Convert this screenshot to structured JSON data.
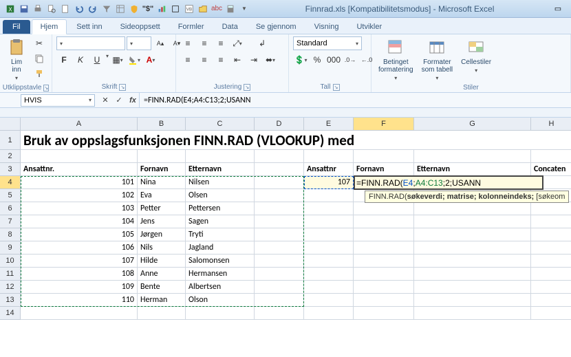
{
  "title": "Finnrad.xls  [Kompatibilitetsmodus] - Microsoft Excel",
  "tabs": {
    "fil": "Fil",
    "hjem": "Hjem",
    "settinn": "Sett inn",
    "sideoppsett": "Sideoppsett",
    "formler": "Formler",
    "data": "Data",
    "segjennom": "Se gjennom",
    "visning": "Visning",
    "utvikler": "Utvikler"
  },
  "ribbon": {
    "clipboard": {
      "paste": "Lim\ninn",
      "label": "Utklippstavle"
    },
    "font": {
      "label": "Skrift",
      "bold": "F",
      "italic": "K",
      "underline": "U"
    },
    "align": {
      "label": "Justering"
    },
    "number": {
      "label": "Tall",
      "format": "Standard"
    },
    "styles": {
      "cond": "Betinget\nformatering",
      "fmttbl": "Formater\nsom tabell",
      "cellstyles": "Cellestiler",
      "label": "Stiler"
    }
  },
  "namebox": "HVIS",
  "formula": "=FINN.RAD(E4;A4:C13;2;USANN",
  "formula_parts": {
    "fn": "=FINN.RAD(",
    "r1": "E4",
    "sep1": ";",
    "r2": "A4:C13",
    "sep2": ";2;USANN"
  },
  "tooltip": {
    "fn": "FINN.RAD(",
    "sig": "søkeverdi; matrise; kolonneindeks; ",
    "opt": "[søkeom"
  },
  "cols": [
    "A",
    "B",
    "C",
    "D",
    "E",
    "F",
    "G",
    "H"
  ],
  "rows": [
    "1",
    "2",
    "3",
    "4",
    "5",
    "6",
    "7",
    "8",
    "9",
    "10",
    "11",
    "12",
    "13",
    "14"
  ],
  "sheet": {
    "title_row": "Bruk av oppslagsfunksjonen FINN.RAD (VLOOKUP) med",
    "hdr": {
      "a": "Ansattnr.",
      "b": "Fornavn",
      "c": "Etternavn",
      "e": "Ansattnr",
      "f": "Fornavn",
      "g": "Etternavn",
      "h": "Concaten"
    },
    "lookup_value": "107",
    "data": [
      {
        "n": "101",
        "f": "Nina",
        "e": "Nilsen"
      },
      {
        "n": "102",
        "f": "Eva",
        "e": "Olsen"
      },
      {
        "n": "103",
        "f": "Petter",
        "e": "Pettersen"
      },
      {
        "n": "104",
        "f": "Jens",
        "e": "Sagen"
      },
      {
        "n": "105",
        "f": "Jørgen",
        "e": "Tryti"
      },
      {
        "n": "106",
        "f": "Nils",
        "e": "Jagland"
      },
      {
        "n": "107",
        "f": "Hilde",
        "e": "Salomonsen"
      },
      {
        "n": "108",
        "f": "Anne",
        "e": "Hermansen"
      },
      {
        "n": "109",
        "f": "Bente",
        "e": "Albertsen"
      },
      {
        "n": "110",
        "f": "Herman",
        "e": "Olson"
      }
    ]
  }
}
